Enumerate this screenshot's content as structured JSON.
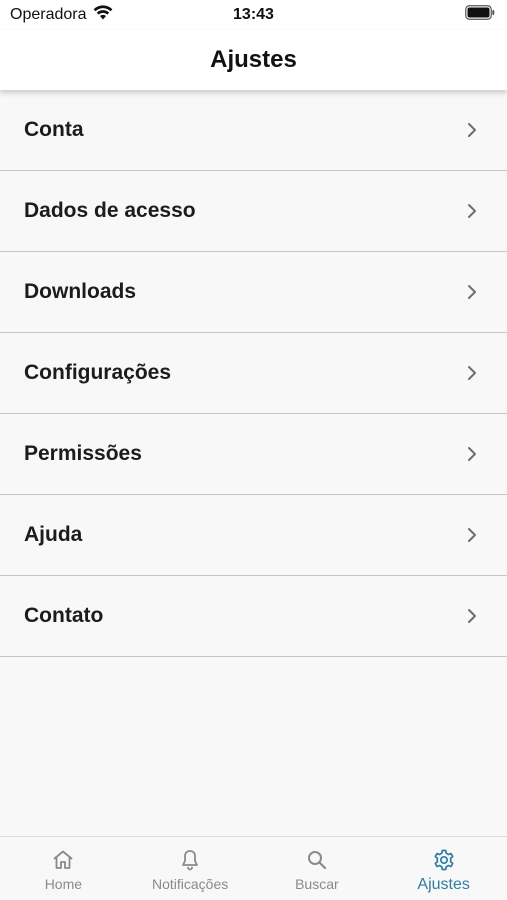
{
  "status_bar": {
    "carrier": "Operadora",
    "time": "13:43"
  },
  "header": {
    "title": "Ajustes"
  },
  "menu": {
    "items": [
      {
        "label": "Conta"
      },
      {
        "label": "Dados de acesso"
      },
      {
        "label": "Downloads"
      },
      {
        "label": "Configurações"
      },
      {
        "label": "Permissões"
      },
      {
        "label": "Ajuda"
      },
      {
        "label": "Contato"
      }
    ]
  },
  "tab_bar": {
    "tabs": [
      {
        "label": "Home",
        "icon": "home-icon"
      },
      {
        "label": "Notificações",
        "icon": "bell-icon"
      },
      {
        "label": "Buscar",
        "icon": "search-icon"
      },
      {
        "label": "Ajustes",
        "icon": "gear-icon",
        "active": true
      }
    ]
  },
  "colors": {
    "accent": "#2f7ea2",
    "inactive": "#8a8a8e",
    "background": "#f8f8f8",
    "separator": "#c6c6c8"
  }
}
